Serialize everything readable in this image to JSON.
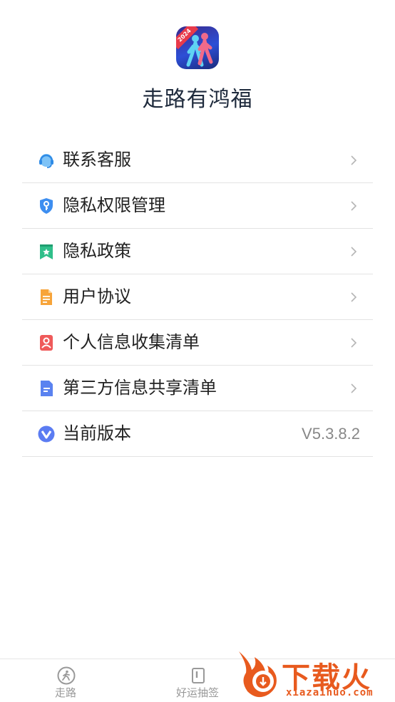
{
  "app": {
    "name": "走路有鸿福",
    "logo_badge": "2024"
  },
  "menu": {
    "items": [
      {
        "label": "联系客服",
        "icon": "headset-icon"
      },
      {
        "label": "隐私权限管理",
        "icon": "shield-key-icon"
      },
      {
        "label": "隐私政策",
        "icon": "bookmark-star-icon"
      },
      {
        "label": "用户协议",
        "icon": "document-icon"
      },
      {
        "label": "个人信息收集清单",
        "icon": "person-card-icon"
      },
      {
        "label": "第三方信息共享清单",
        "icon": "file-share-icon"
      },
      {
        "label": "当前版本",
        "icon": "version-v-icon",
        "value": "V5.3.8.2"
      }
    ]
  },
  "tabbar": {
    "tabs": [
      {
        "label": "走路",
        "icon": "walk-icon"
      },
      {
        "label": "好运抽签",
        "icon": "lottery-box-icon"
      }
    ]
  },
  "watermark": {
    "text": "下载火",
    "url": "xiazaihuo.com"
  },
  "colors": {
    "accent_text": "#1e2a3c",
    "divider": "#e3e3e3",
    "watermark": "#e85a1e"
  }
}
